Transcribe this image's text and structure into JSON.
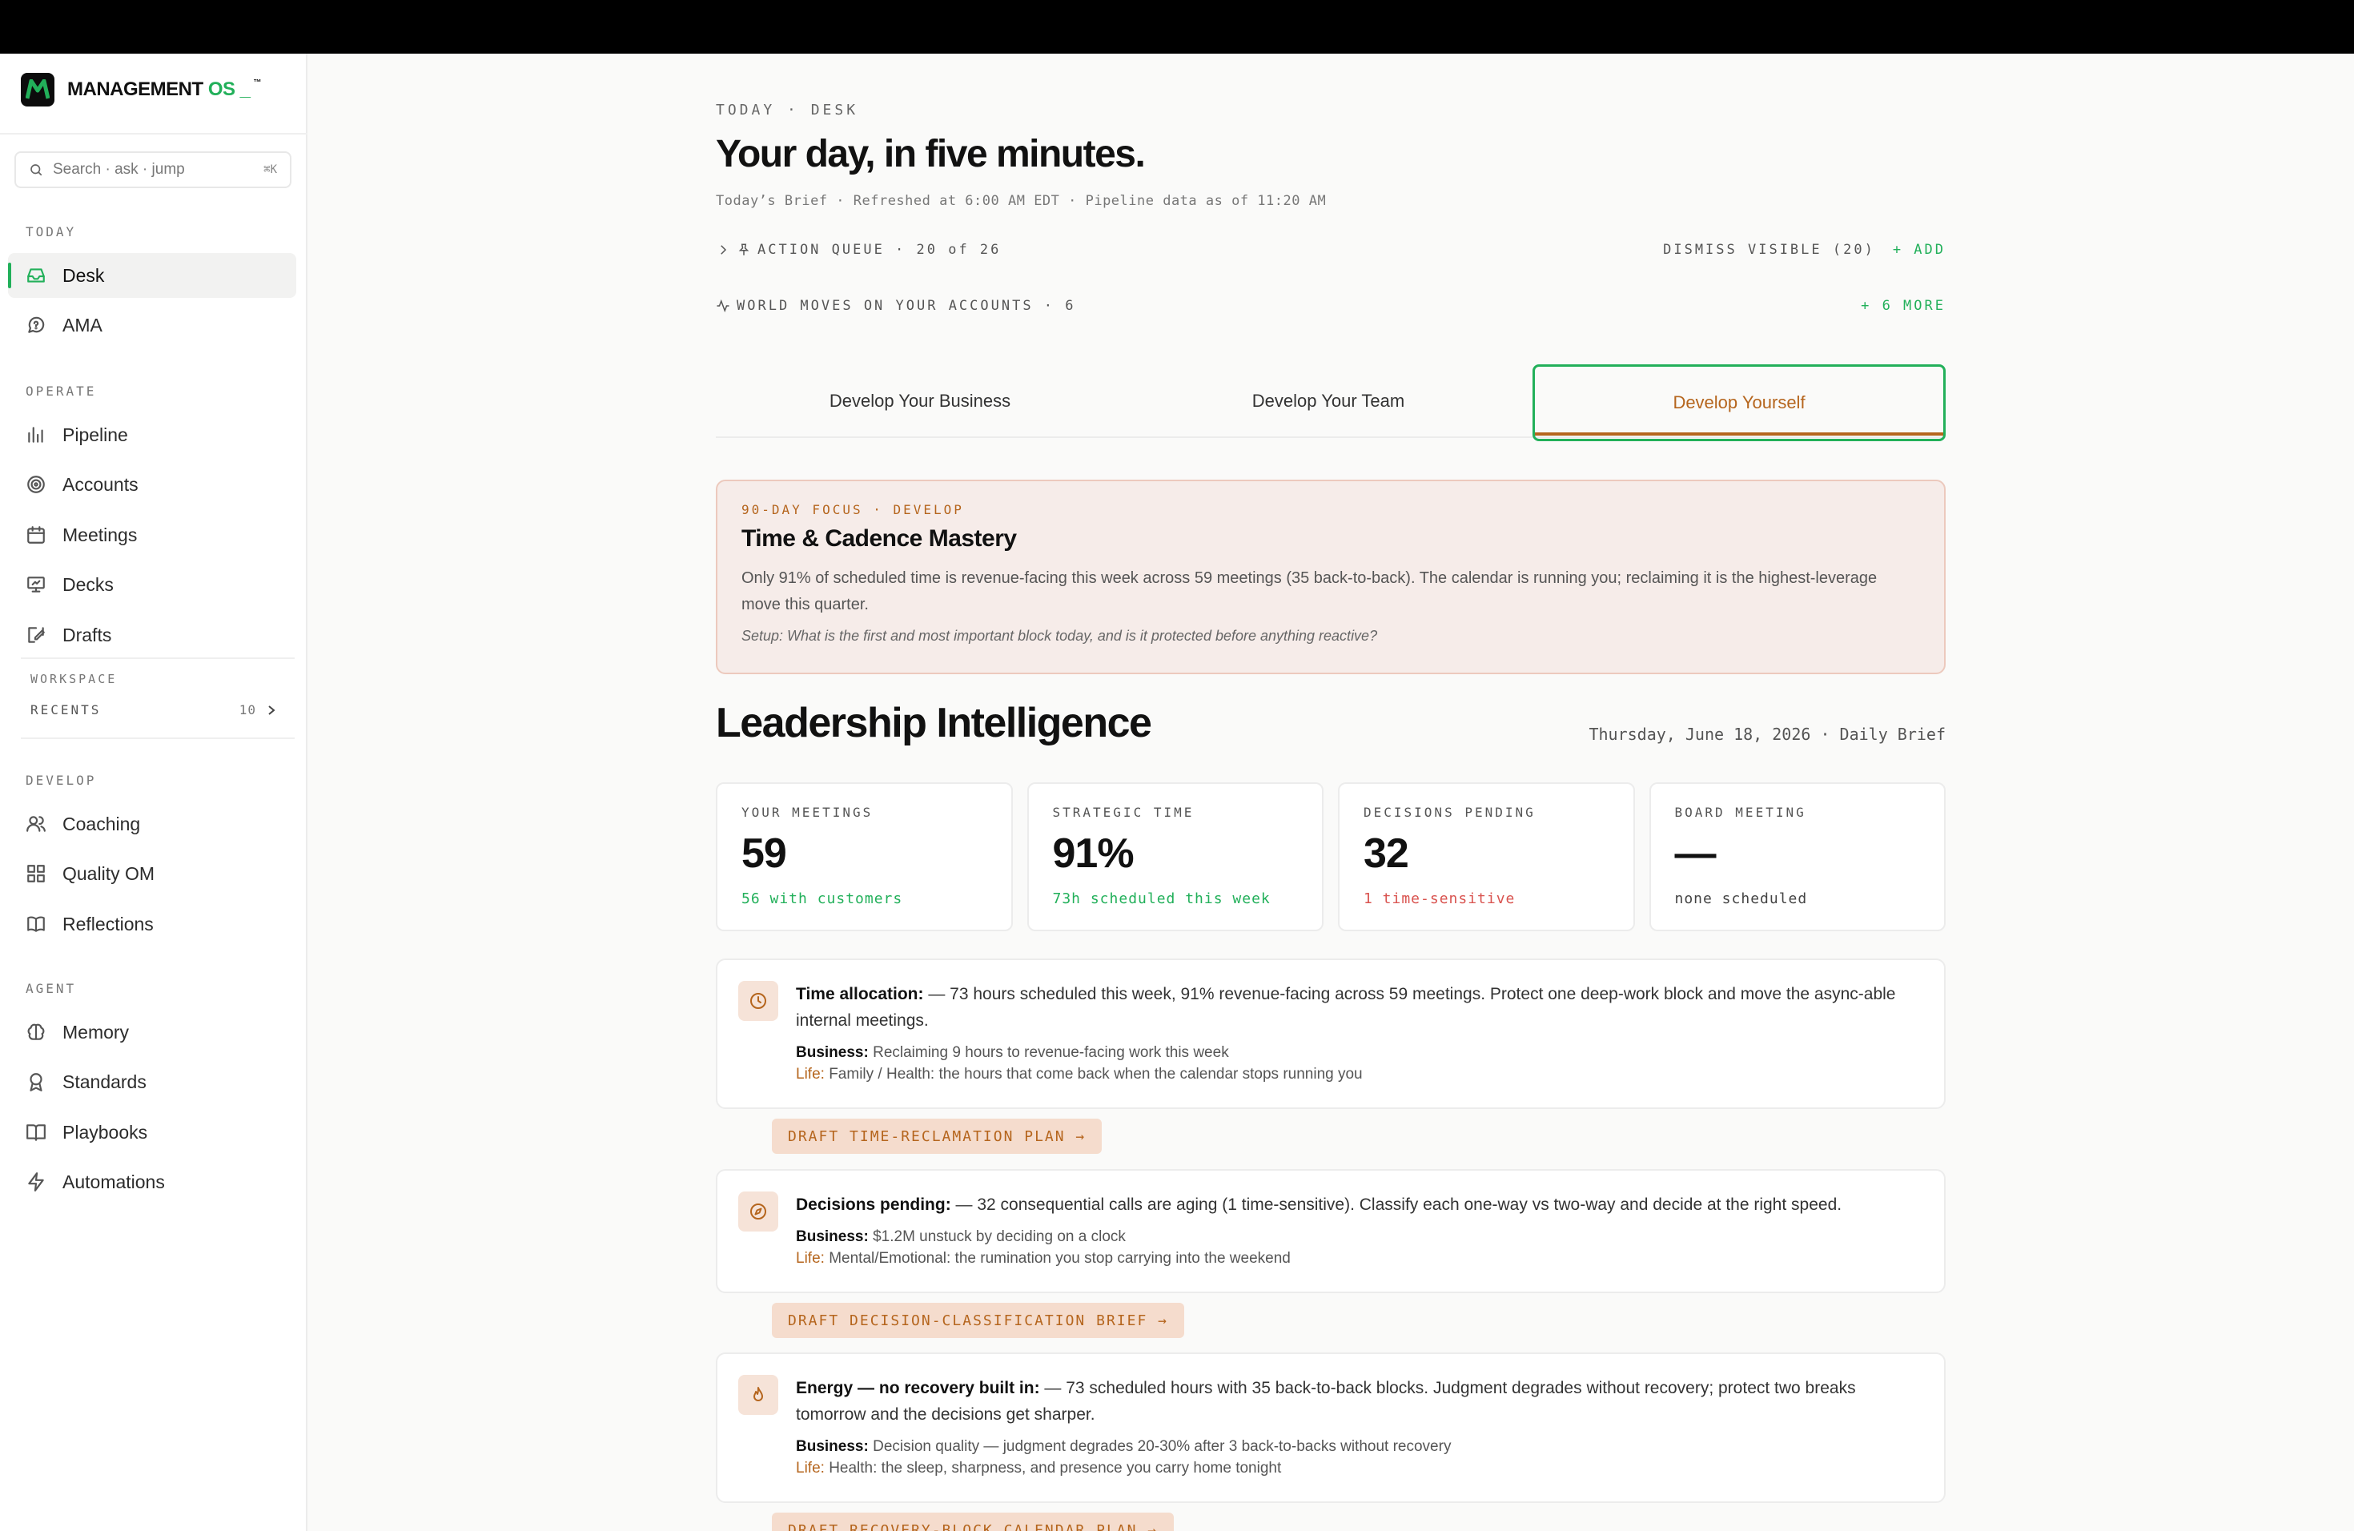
{
  "brand": {
    "name": "MANAGEMENT",
    "suffix": "OS _",
    "tm": "™"
  },
  "search": {
    "placeholder": "Search · ask · jump",
    "shortcut": "⌘K"
  },
  "sidebar": {
    "today_label": "TODAY",
    "today_items": [
      {
        "label": "Desk",
        "icon": "inbox-icon",
        "active": true
      },
      {
        "label": "AMA",
        "icon": "chat-help-icon"
      }
    ],
    "operate_label": "OPERATE",
    "operate_items": [
      {
        "label": "Pipeline",
        "icon": "bar-chart-icon"
      },
      {
        "label": "Accounts",
        "icon": "target-icon"
      },
      {
        "label": "Meetings",
        "icon": "calendar-icon"
      },
      {
        "label": "Decks",
        "icon": "presentation-icon"
      },
      {
        "label": "Drafts",
        "icon": "edit-icon"
      }
    ],
    "workspace_label": "WORKSPACE",
    "recents_label": "RECENTS",
    "recents_count": "10",
    "develop_label": "DEVELOP",
    "develop_items": [
      {
        "label": "Coaching",
        "icon": "users-icon"
      },
      {
        "label": "Quality OM",
        "icon": "grid-icon"
      },
      {
        "label": "Reflections",
        "icon": "book-icon"
      }
    ],
    "agent_label": "AGENT",
    "agent_items": [
      {
        "label": "Memory",
        "icon": "brain-icon"
      },
      {
        "label": "Standards",
        "icon": "award-icon"
      },
      {
        "label": "Playbooks",
        "icon": "book-open-icon"
      },
      {
        "label": "Automations",
        "icon": "bolt-icon"
      }
    ]
  },
  "header": {
    "eyebrow": "TODAY · DESK",
    "title": "Your day, in five minutes.",
    "meta": "Today’s Brief · Refreshed at 6:00 AM EDT · Pipeline data as of 11:20 AM"
  },
  "queue": {
    "label": "ACTION QUEUE · 20 of 26",
    "dismiss": "DISMISS VISIBLE (20)",
    "add": "+ ADD"
  },
  "world": {
    "label": "WORLD MOVES ON YOUR ACCOUNTS · 6",
    "more": "+ 6 MORE"
  },
  "tabs": [
    {
      "label": "Develop Your Business"
    },
    {
      "label": "Develop Your Team"
    },
    {
      "label": "Develop Yourself",
      "active": true
    }
  ],
  "focus": {
    "eyebrow": "90-DAY FOCUS · DEVELOP",
    "title": "Time & Cadence Mastery",
    "body": "Only 91% of scheduled time is revenue-facing this week across 59 meetings (35 back-to-back). The calendar is running you; reclaiming it is the highest-leverage move this quarter.",
    "setup": "Setup: What is the first and most important block today, and is it protected before anything reactive?"
  },
  "intel": {
    "title": "Leadership Intelligence",
    "date": "Thursday, June 18, 2026 · Daily Brief",
    "stats": [
      {
        "label": "YOUR MEETINGS",
        "value": "59",
        "sub": "56 with customers",
        "tone": "green"
      },
      {
        "label": "STRATEGIC TIME",
        "value": "91%",
        "sub": "73h scheduled this week",
        "tone": "green"
      },
      {
        "label": "DECISIONS PENDING",
        "value": "32",
        "sub": "1 time-sensitive",
        "tone": "red"
      },
      {
        "label": "BOARD MEETING",
        "value": "—",
        "sub": "none scheduled",
        "tone": "gray"
      }
    ]
  },
  "insights": [
    {
      "icon": "clock-icon",
      "title": "Time allocation:",
      "text": " — 73 hours scheduled this week, 91% revenue-facing across 59 meetings. Protect one deep-work block and move the async-able internal meetings.",
      "business_label": "Business:",
      "business": " Reclaiming 9 hours to revenue-facing work this week",
      "life_label": "Life:",
      "life": " Family / Health: the hours that come back when the calendar stops running you",
      "action": "DRAFT TIME-RECLAMATION PLAN →"
    },
    {
      "icon": "compass-icon",
      "title": "Decisions pending:",
      "text": " — 32 consequential calls are aging (1 time-sensitive). Classify each one-way vs two-way and decide at the right speed.",
      "business_label": "Business:",
      "business": " $1.2M unstuck by deciding on a clock",
      "life_label": "Life:",
      "life": " Mental/Emotional: the rumination you stop carrying into the weekend",
      "action": "DRAFT DECISION-CLASSIFICATION BRIEF →"
    },
    {
      "icon": "flame-icon",
      "title": "Energy — no recovery built in:",
      "text": " — 73 scheduled hours with 35 back-to-back blocks. Judgment degrades without recovery; protect two breaks tomorrow and the decisions get sharper.",
      "business_label": "Business:",
      "business": " Decision quality — judgment degrades 20-30% after 3 back-to-backs without recovery",
      "life_label": "Life:",
      "life": " Health: the sleep, sharpness, and presence you carry home tonight",
      "action": "DRAFT RECOVERY-BLOCK CALENDAR PLAN →"
    }
  ],
  "colors": {
    "accent": "#22b05a",
    "develop": "#b5651d",
    "danger": "#d9534f"
  }
}
